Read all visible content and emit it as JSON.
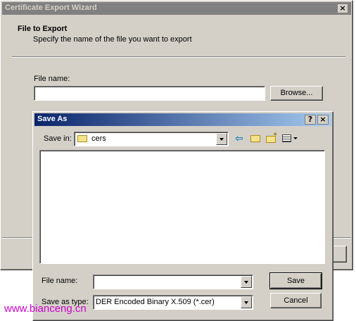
{
  "wizard": {
    "title": "Certificate Export Wizard",
    "heading": "File to Export",
    "subtitle": "Specify the name of the file you want to export",
    "file_label": "File name:",
    "file_value": "",
    "browse_label": "Browse..."
  },
  "dialog": {
    "title": "Save As",
    "help_label": "?",
    "close_label": "×",
    "save_in_label": "Save in:",
    "save_in_value": "cers",
    "file_name_label": "File name:",
    "file_name_value": "",
    "save_type_label": "Save as type:",
    "save_type_value": "DER Encoded Binary X.509 (*.cer)",
    "save_label": "Save",
    "cancel_label": "Cancel"
  },
  "watermark": "www.bianceng.cn",
  "colors": {
    "title_active_start": "#0a246a",
    "title_active_end": "#a6caf0",
    "title_inactive": "#808080",
    "watermark": "#cc00cc"
  }
}
